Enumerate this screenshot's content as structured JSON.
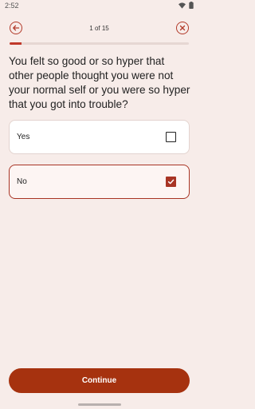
{
  "status_bar": {
    "time": "2:52",
    "icons": [
      "wifi-icon",
      "battery-icon"
    ]
  },
  "header": {
    "back_icon": "arrow-left-icon",
    "close_icon": "close-icon",
    "progress_label": "1 of 15",
    "progress_fraction": 0.067
  },
  "question": {
    "text": "You felt so good or so hyper that other people thought you were not your normal self or you were so hyper that you got into trouble?"
  },
  "options": [
    {
      "label": "Yes",
      "checked": false
    },
    {
      "label": "No",
      "checked": true
    }
  ],
  "continue_button": {
    "label": "Continue"
  },
  "colors": {
    "accent": "#a83424",
    "button": "#a6320f",
    "background": "#f7ece9"
  }
}
